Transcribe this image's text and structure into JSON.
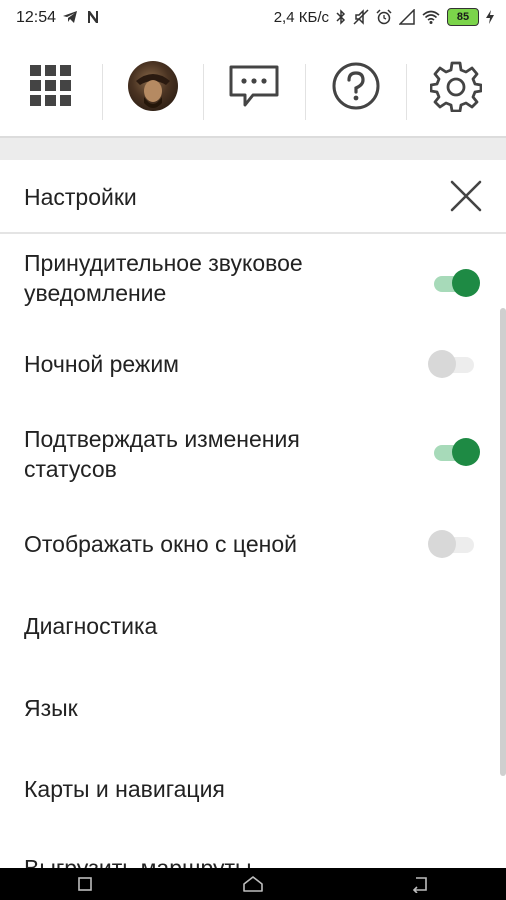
{
  "status_bar": {
    "time": "12:54",
    "left_icons": [
      "telegram-icon",
      "n-notification-icon"
    ],
    "network_speed": "2,4 КБ/с",
    "right_icons": [
      "bluetooth-icon",
      "mute-icon",
      "alarm-icon",
      "signal-icon",
      "wifi-icon"
    ],
    "battery": "85"
  },
  "toolbar": {
    "icons": [
      "apps-grid-icon",
      "avatar",
      "chat-icon",
      "help-icon",
      "gear-icon"
    ]
  },
  "settings": {
    "title": "Настройки",
    "items": [
      {
        "label_line1": "Принудительное звуковое",
        "label_line2": "уведомление",
        "toggle": true
      },
      {
        "label": "Ночной режим",
        "toggle": false
      },
      {
        "label_line1": "Подтверждать изменения",
        "label_line2": "статусов",
        "toggle": true
      },
      {
        "label": "Отображать окно с ценой",
        "toggle": false
      },
      {
        "label": "Диагностика"
      },
      {
        "label": "Язык"
      },
      {
        "label": "Карты и навигация"
      },
      {
        "label": "Выгрузить маршруты"
      }
    ]
  },
  "colors": {
    "toggle_on": "#1e8a44",
    "toggle_on_track": "#a7dab9",
    "toggle_off": "#d8d8d8",
    "battery": "#7bd44a"
  }
}
